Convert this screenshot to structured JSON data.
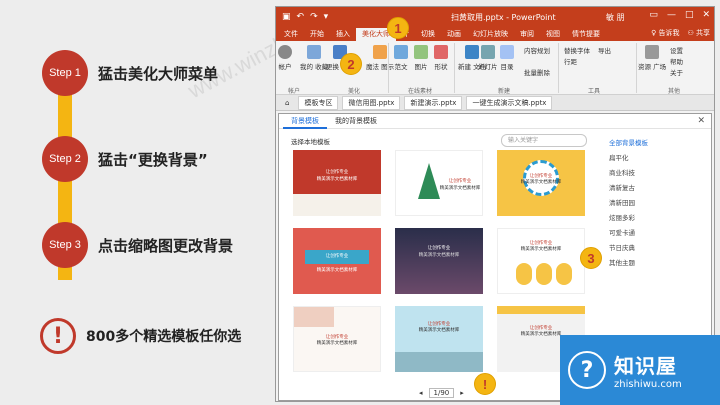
{
  "steps": [
    {
      "badge": "Step 1",
      "label": "猛击美化大师菜单"
    },
    {
      "badge": "Step 2",
      "label": "猛击“更换背景”"
    },
    {
      "badge": "Step 3",
      "label": "点击缩略图更改背景"
    }
  ],
  "tip": {
    "icon": "!",
    "label": "800多个精选模板任你选"
  },
  "window": {
    "title": "扫黄取用.pptx - PowerPoint",
    "user": "敏 朋",
    "tabs": [
      "文件",
      "开始",
      "插入",
      "美化大师",
      "计",
      "切换",
      "动画",
      "幻灯片放映",
      "审阅",
      "视图",
      "情节提要"
    ],
    "active_tab": "美化大师",
    "tell_me": "告诉我",
    "share": "共享",
    "ribbon": {
      "account": "帐户",
      "my_fav": "我的\n收藏",
      "change_bg": "更换\n背景",
      "magic": "魔法\n图示",
      "fan_wen": "范文",
      "tu_pian": "图片",
      "xing_zhuang": "形状",
      "new_doc": "新建\n文档",
      "slides": "幻灯片",
      "dir": "目录",
      "content_plan": "内容规划",
      "img_export": "导出",
      "replace_font": "替换字体",
      "line_space": "行距",
      "batch_delete": "批量删除",
      "res_plaza": "资源\n广场",
      "settings": "设置",
      "help": "帮助",
      "about": "关于",
      "group_beautify": "美化",
      "group_online": "在线素材",
      "group_new": "新建",
      "group_tools": "工具",
      "group_other": "其他"
    },
    "doc_tabs": [
      "模板专区",
      "微信用图.pptx",
      "新建演示.pptx",
      "一键生成演示文稿.pptx"
    ]
  },
  "dialog": {
    "tabs": [
      "背景模板",
      "我的背景模板"
    ],
    "active_tab": "背景模板",
    "local_choose": "选择本地模板",
    "search_placeholder": "输入关键字",
    "categories": [
      "全部背景模板",
      "扁平化",
      "商业科技",
      "清新复古",
      "清新田园",
      "炫丽多彩",
      "可爱卡通",
      "节日庆典",
      "其他主题"
    ],
    "active_category": "全部背景模板",
    "thumb_text": [
      "让创作专业",
      "精美演示文档素材库"
    ],
    "page": "1/90"
  },
  "callouts": [
    "1",
    "2",
    "3",
    "!"
  ],
  "watermark": "www.winzhe.com",
  "logo": {
    "cn": "知识屋",
    "en": "zhishiwu.com",
    "icon": "?"
  }
}
